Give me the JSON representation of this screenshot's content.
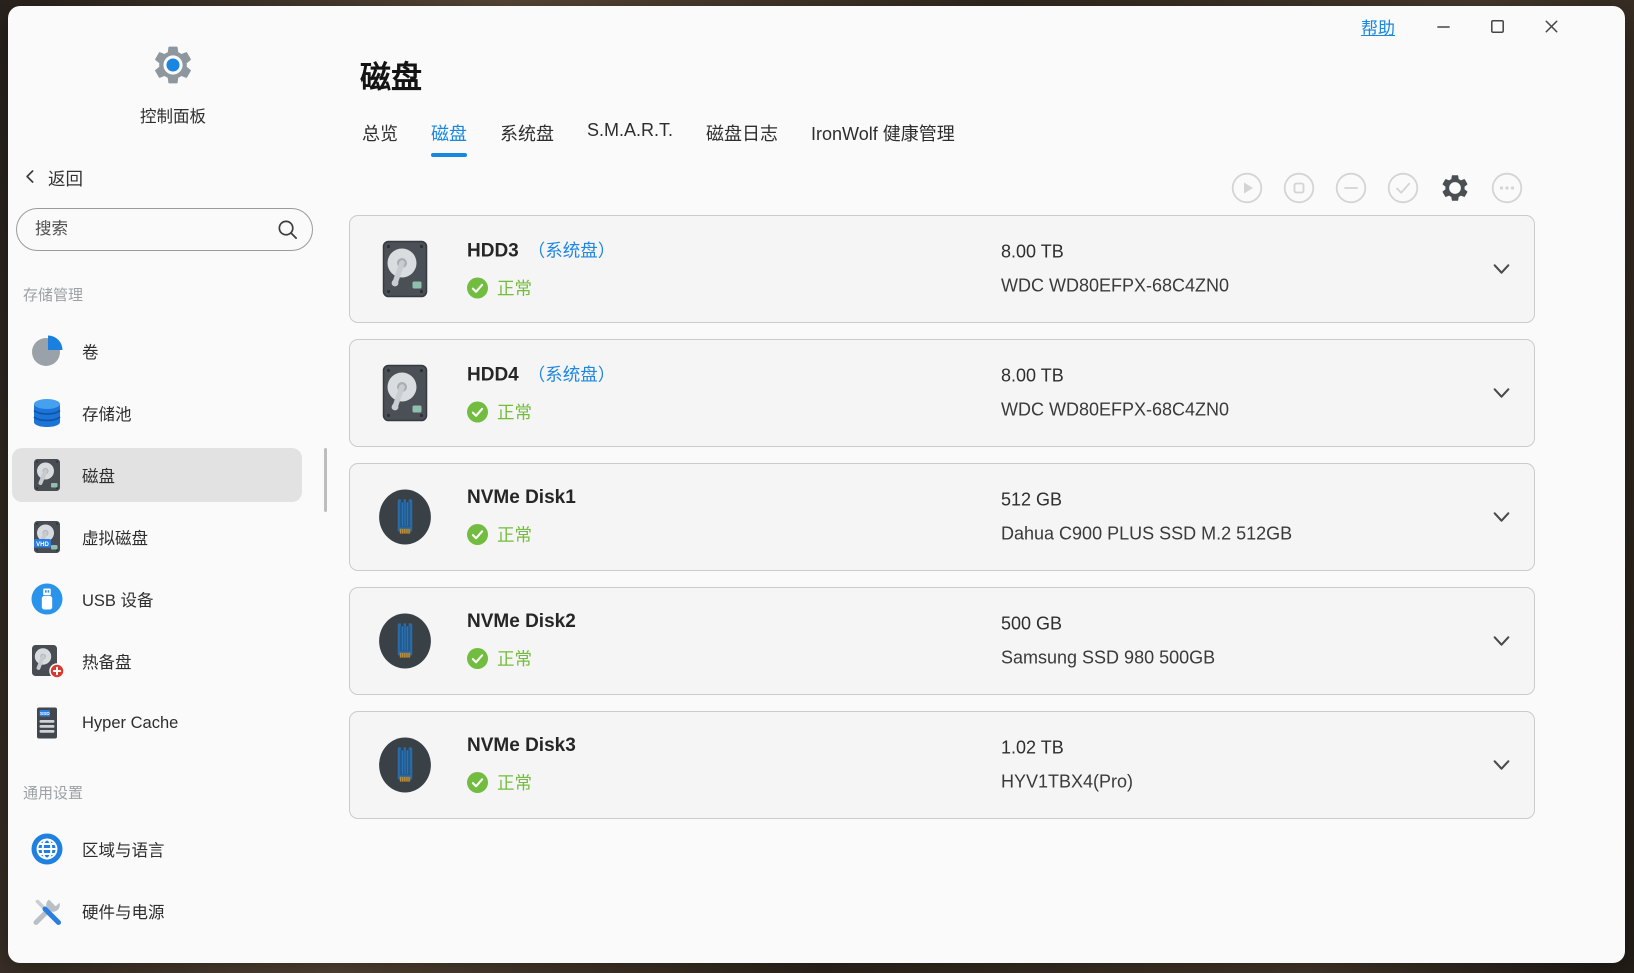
{
  "window": {
    "help_label": "帮助",
    "controls": [
      "minimize-icon",
      "maximize-icon",
      "close-icon"
    ]
  },
  "app": {
    "icon": "gear-icon",
    "label": "控制面板"
  },
  "back_label": "返回",
  "search": {
    "placeholder": "搜索"
  },
  "sidebar": {
    "sections": [
      {
        "title": "存储管理",
        "items": [
          {
            "label": "卷",
            "icon": "volume-pie-icon",
            "active": false
          },
          {
            "label": "存储池",
            "icon": "storage-pool-icon",
            "active": false
          },
          {
            "label": "磁盘",
            "icon": "disk-icon",
            "active": true
          },
          {
            "label": "虚拟磁盘",
            "icon": "virtual-disk-icon",
            "active": false
          },
          {
            "label": "USB 设备",
            "icon": "usb-icon",
            "active": false
          },
          {
            "label": "热备盘",
            "icon": "hot-spare-icon",
            "active": false
          },
          {
            "label": "Hyper Cache",
            "icon": "hyper-cache-icon",
            "active": false
          }
        ]
      },
      {
        "title": "通用设置",
        "items": [
          {
            "label": "区域与语言",
            "icon": "globe-icon",
            "active": false
          },
          {
            "label": "硬件与电源",
            "icon": "hardware-power-icon",
            "active": false
          }
        ]
      }
    ]
  },
  "main": {
    "title": "磁盘",
    "tabs": [
      {
        "label": "总览",
        "active": false
      },
      {
        "label": "磁盘",
        "active": true
      },
      {
        "label": "系统盘",
        "active": false
      },
      {
        "label": "S.M.A.R.T.",
        "active": false
      },
      {
        "label": "磁盘日志",
        "active": false
      },
      {
        "label": "IronWolf 健康管理",
        "active": false
      }
    ],
    "toolbar": [
      {
        "icon": "play-circle-icon",
        "enabled": false
      },
      {
        "icon": "stop-circle-icon",
        "enabled": false
      },
      {
        "icon": "minus-circle-icon",
        "enabled": false
      },
      {
        "icon": "check-circle-icon",
        "enabled": false
      },
      {
        "icon": "settings-gear-icon",
        "enabled": true
      },
      {
        "icon": "more-circle-icon",
        "enabled": false
      }
    ],
    "disks": [
      {
        "name": "HDD3",
        "tag": "（系统盘）",
        "status": "正常",
        "capacity": "8.00 TB",
        "model": "WDC WD80EFPX-68C4ZN0",
        "type": "hdd"
      },
      {
        "name": "HDD4",
        "tag": "（系统盘）",
        "status": "正常",
        "capacity": "8.00 TB",
        "model": "WDC WD80EFPX-68C4ZN0",
        "type": "hdd"
      },
      {
        "name": "NVMe Disk1",
        "tag": "",
        "status": "正常",
        "capacity": "512 GB",
        "model": "Dahua C900 PLUS SSD M.2 512GB",
        "type": "nvme"
      },
      {
        "name": "NVMe Disk2",
        "tag": "",
        "status": "正常",
        "capacity": "500 GB",
        "model": "Samsung SSD 980 500GB",
        "type": "nvme"
      },
      {
        "name": "NVMe Disk3",
        "tag": "",
        "status": "正常",
        "capacity": "1.02 TB",
        "model": "HYV1TBX4(Pro)",
        "type": "nvme"
      }
    ]
  },
  "colors": {
    "accent": "#1787e0",
    "status_ok": "#74bd3c"
  }
}
